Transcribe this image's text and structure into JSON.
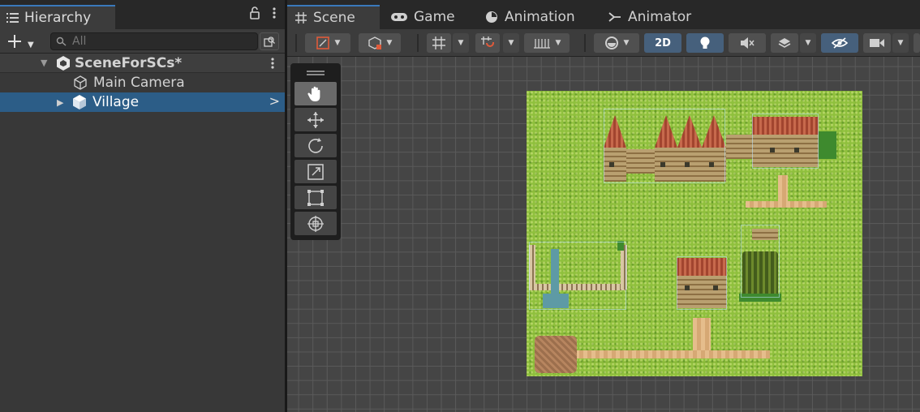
{
  "hierarchy": {
    "tab_label": "Hierarchy",
    "search_placeholder": "All",
    "items": [
      {
        "label": "SceneForSCs*"
      },
      {
        "label": "Main Camera"
      },
      {
        "label": "Village"
      }
    ]
  },
  "scene_tabs": [
    {
      "label": "Scene"
    },
    {
      "label": "Game"
    },
    {
      "label": "Animation"
    },
    {
      "label": "Animator"
    }
  ],
  "scene_toolbar": {
    "mode_2d_label": "2D"
  },
  "colors": {
    "selection": "#2c5d87",
    "accent": "#3a79bb",
    "toggle_active": "#46607c"
  },
  "icons": [
    "list-icon",
    "lock-icon",
    "kebab-icon",
    "search-icon",
    "search-mode-icon",
    "unity-scene-icon",
    "gameobject-icon",
    "prefab-icon",
    "grid-icon",
    "gamepad-icon",
    "clock-icon",
    "animator-icon",
    "hand-icon",
    "move-icon",
    "rotate-icon",
    "scale-icon",
    "rect-icon",
    "transform-icon"
  ]
}
